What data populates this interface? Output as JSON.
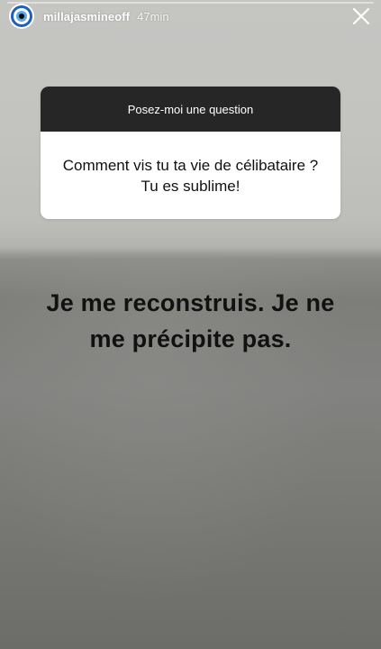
{
  "story": {
    "username": "millajasmineoff",
    "time": "47min",
    "progress": 0.0
  },
  "question_box": {
    "header": "Posez-moi une question",
    "question": "Comment vis tu ta vie de célibataire ? Tu es sublime!"
  },
  "answer": {
    "line1": "Je me reconstruis. Je ne",
    "line2": "me précipite pas."
  },
  "icons": {
    "avatar": "evil-eye-icon",
    "close": "close-icon"
  },
  "colors": {
    "question_header_bg": "#262626",
    "question_body_bg": "#ffffff",
    "answer_text": "#111111",
    "evil_eye_blue": "#1f5fbf"
  }
}
